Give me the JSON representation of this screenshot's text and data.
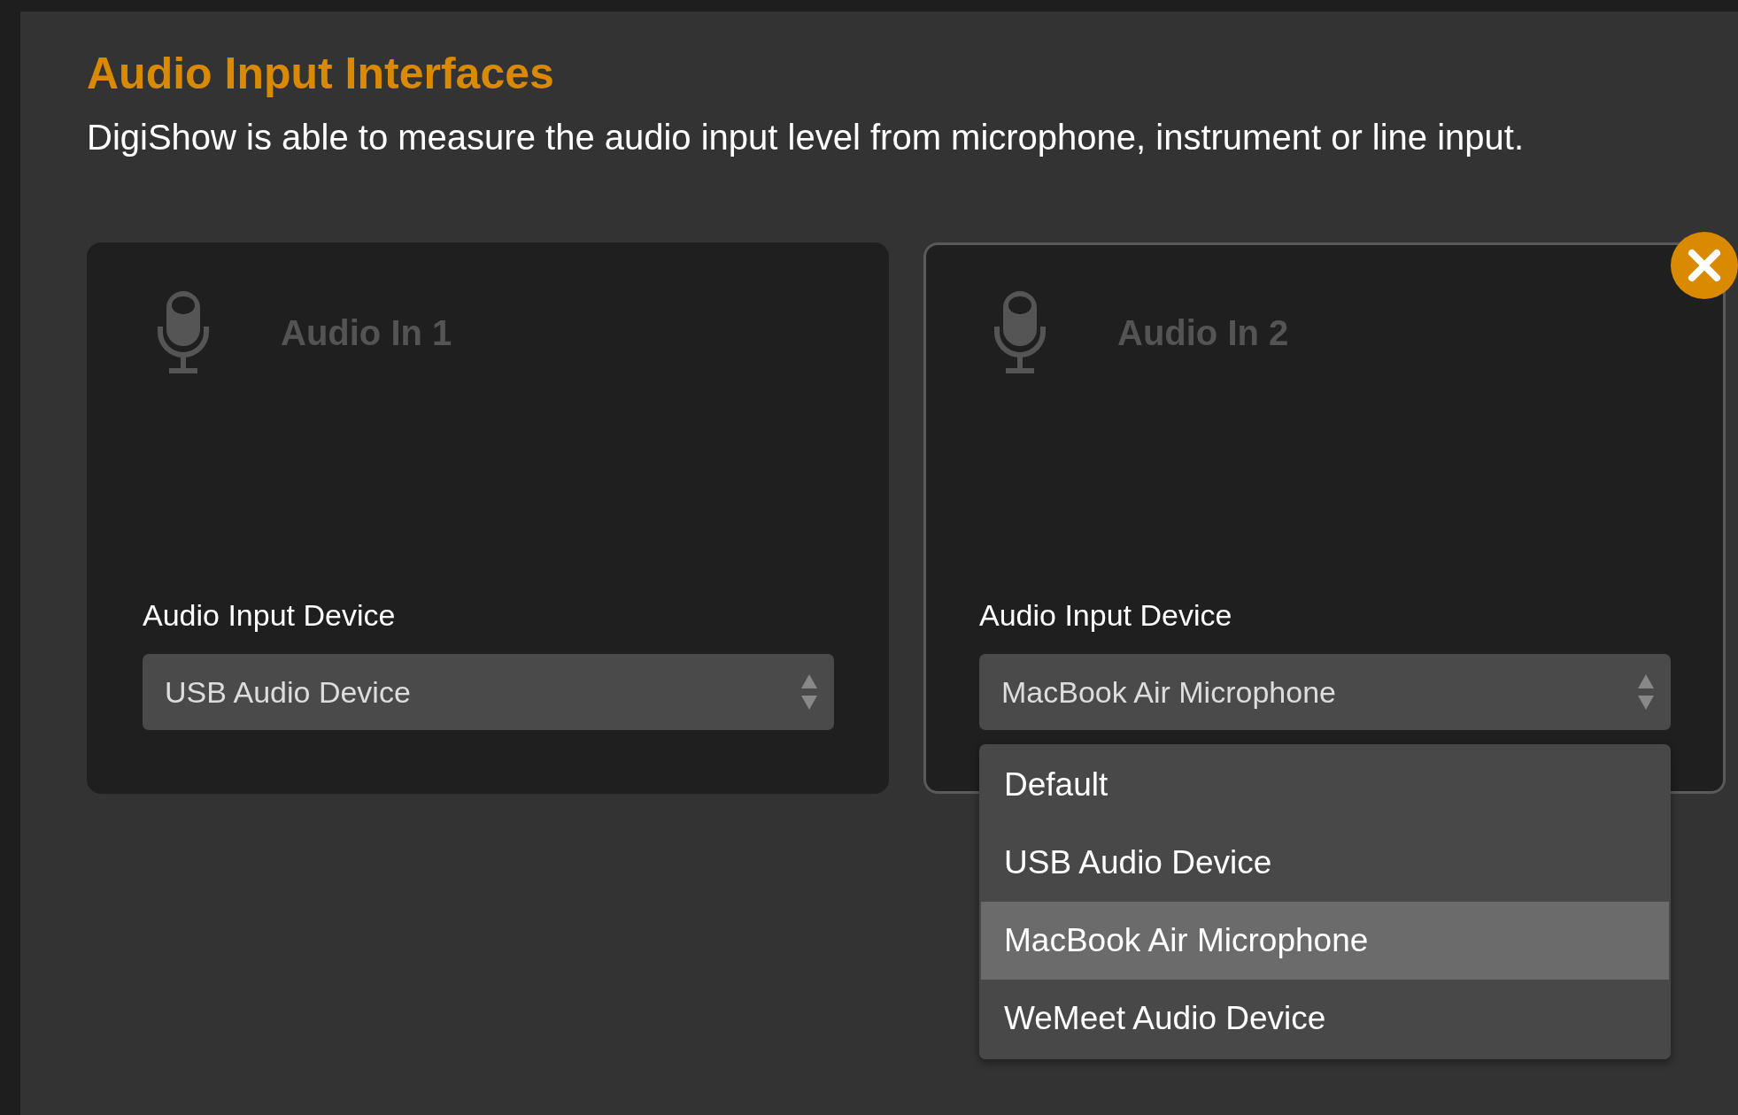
{
  "title": "Audio Input Interfaces",
  "description": "DigiShow is able to measure the audio input level from microphone, instrument or line input.",
  "cards": [
    {
      "title": "Audio In 1",
      "selected": false,
      "device_label": "Audio Input Device",
      "device": {
        "value": "USB Audio Device"
      }
    },
    {
      "title": "Audio In 2",
      "selected": true,
      "device_label": "Audio Input Device",
      "device": {
        "value": "MacBook Air Microphone",
        "options": [
          {
            "label": "Default",
            "selected": false
          },
          {
            "label": "USB Audio Device",
            "selected": false
          },
          {
            "label": "MacBook Air Microphone",
            "selected": true
          },
          {
            "label": "WeMeet Audio Device",
            "selected": false
          }
        ]
      }
    }
  ]
}
